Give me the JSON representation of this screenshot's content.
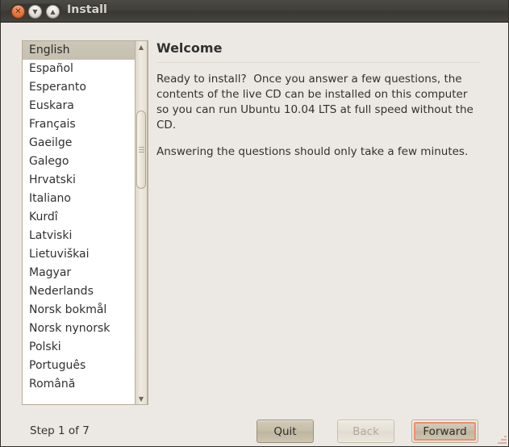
{
  "window": {
    "title": "Install",
    "controls": [
      {
        "name": "close",
        "glyph": "✕"
      },
      {
        "name": "minimize",
        "glyph": "▼"
      },
      {
        "name": "maximize",
        "glyph": "▲"
      }
    ]
  },
  "language_list": {
    "selected": "English",
    "items": [
      "English",
      "Español",
      "Esperanto",
      "Euskara",
      "Français",
      "Gaeilge",
      "Galego",
      "Hrvatski",
      "Italiano",
      "Kurdî",
      "Latviski",
      "Lietuviškai",
      "Magyar",
      "Nederlands",
      "Norsk bokmål",
      "Norsk nynorsk",
      "Polski",
      "Português",
      "Română"
    ],
    "scrollbar": {
      "up_arrow": "▲",
      "down_arrow": "▼"
    }
  },
  "welcome": {
    "heading": "Welcome",
    "paragraphs": [
      "Ready to install?  Once you answer a few questions, the contents of the live CD can be installed on this computer so you can run Ubuntu 10.04 LTS at full speed without the CD.",
      "Answering the questions should only take a few minutes."
    ]
  },
  "footer": {
    "step_text": "Step 1 of 7",
    "quit_label": "Quit",
    "back_label": "Back",
    "forward_label": "Forward"
  },
  "colors": {
    "window_background": "#ece9e4",
    "titlebar": "#403f3a",
    "close_button": "#e4743d",
    "focus_ring": "#ef8e6c",
    "selection": "#c8c2b3",
    "list_background": "#ffffff"
  }
}
